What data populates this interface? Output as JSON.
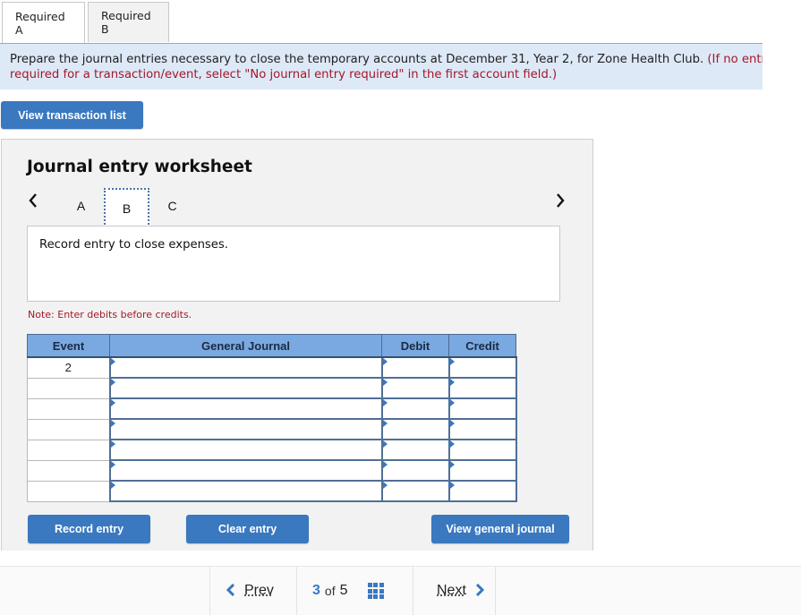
{
  "tabs": [
    {
      "label": "Required A",
      "active": true
    },
    {
      "label": "Required B",
      "active": false
    }
  ],
  "instructions": {
    "main": "Prepare the journal entries necessary to close the temporary accounts at December 31, Year 2, for Zone Health Club. ",
    "note_line1": "(If no entr",
    "line2": "required for a transaction/event, select \"No journal entry required\" in the first account field.)"
  },
  "buttons": {
    "view_transaction_list": "View transaction list",
    "record_entry": "Record entry",
    "clear_entry": "Clear entry",
    "view_general_journal": "View general journal"
  },
  "worksheet": {
    "title": "Journal entry worksheet",
    "nav_prev": "‹",
    "nav_next": "›",
    "steps": [
      "A",
      "B",
      "C"
    ],
    "active_step": "B",
    "description": "Record entry to close expenses.",
    "note": "Note: Enter debits before credits."
  },
  "table": {
    "headers": [
      "Event",
      "General Journal",
      "Debit",
      "Credit"
    ],
    "rows": [
      {
        "event": "2",
        "account": "",
        "debit": "",
        "credit": ""
      },
      {
        "event": "",
        "account": "",
        "debit": "",
        "credit": ""
      },
      {
        "event": "",
        "account": "",
        "debit": "",
        "credit": ""
      },
      {
        "event": "",
        "account": "",
        "debit": "",
        "credit": ""
      },
      {
        "event": "",
        "account": "",
        "debit": "",
        "credit": ""
      },
      {
        "event": "",
        "account": "",
        "debit": "",
        "credit": ""
      },
      {
        "event": "",
        "account": "",
        "debit": "",
        "credit": ""
      }
    ]
  },
  "pagination": {
    "prev_label": "Prev",
    "next_label": "Next",
    "current": "3",
    "of_label": "of",
    "total": "5",
    "icons": {
      "prev": "chevron-left-icon",
      "next": "chevron-right-icon",
      "grid": "grid-icon"
    }
  },
  "colors": {
    "accent": "#3a78bf",
    "header_blue": "#7aa9e2",
    "instruction_bg": "#dde9f6",
    "warning_red": "#a5182a"
  }
}
